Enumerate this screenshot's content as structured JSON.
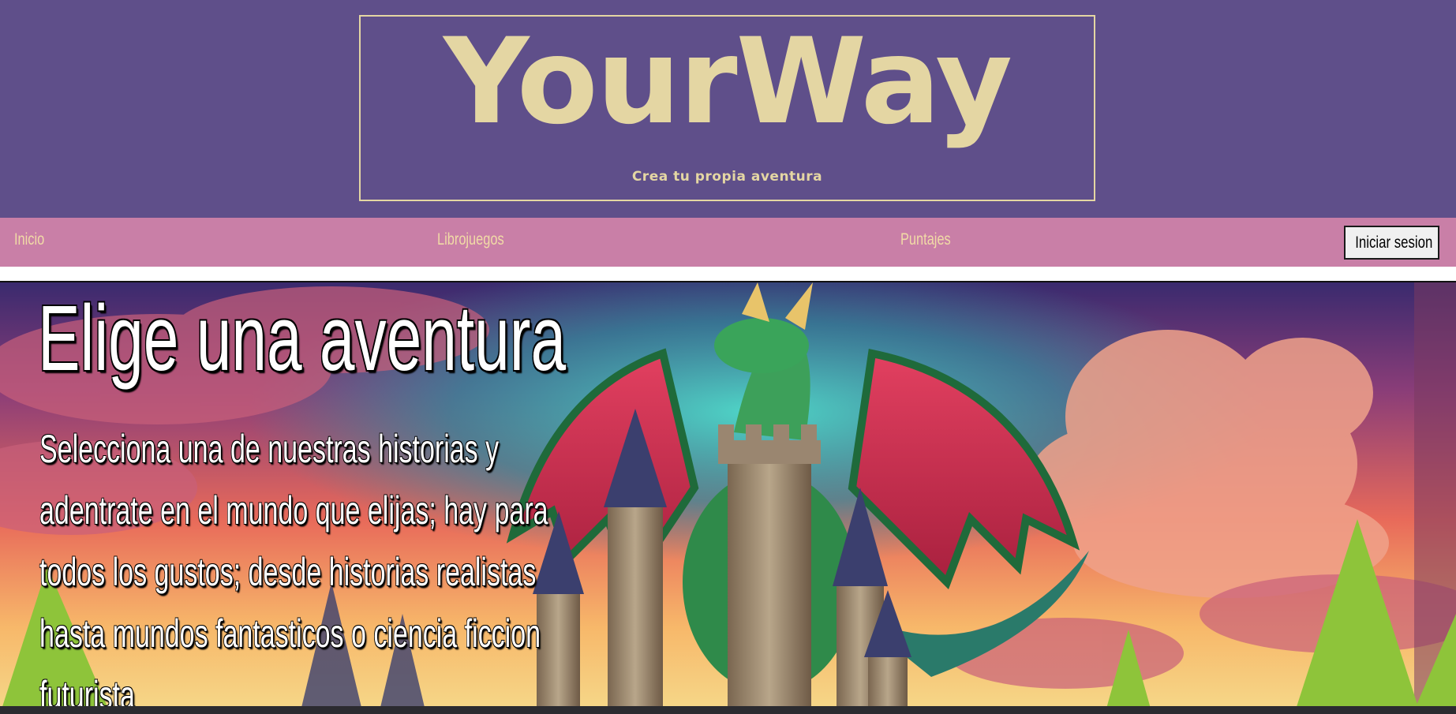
{
  "header": {
    "logo": "YourWay",
    "tagline": "Crea tu propia aventura"
  },
  "nav": {
    "items": [
      {
        "label": "Inicio"
      },
      {
        "label": "Librojuegos"
      },
      {
        "label": "Puntajes"
      }
    ],
    "login_label": "Iniciar sesion"
  },
  "hero": {
    "title": "Elige una aventura",
    "description": "Selecciona una de nuestras historias y adentrate en el mundo que elijas; hay para todos los gustos; desde historias realistas hasta mundos fantasticos o ciencia ficcion futurista"
  },
  "colors": {
    "header_bg": "#5f4f8a",
    "accent": "#e4d6a3",
    "nav_bg": "#c97fa7",
    "nav_text": "#f1dba6"
  },
  "icons": {
    "hero_image": "dragon-castle-illustration"
  }
}
